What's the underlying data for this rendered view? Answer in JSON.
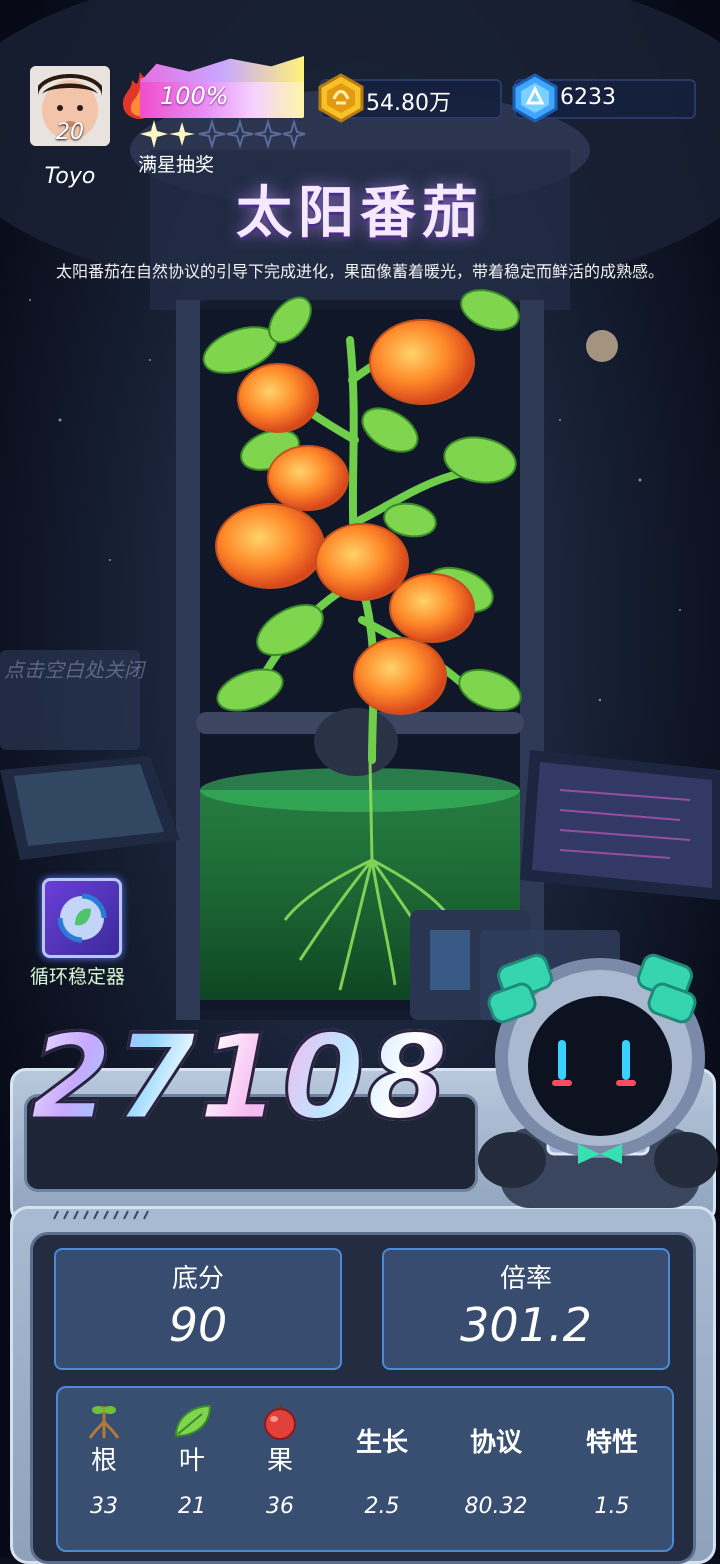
{
  "player": {
    "level": "20",
    "name": "Toyo",
    "progress_percent": "100%",
    "progress_fraction": 1.0,
    "stars_filled": 2,
    "stars_total": 6,
    "lottery_label": "满星抽奖"
  },
  "currency": {
    "coins": "54.80万",
    "coin_icon": "gold-coin-icon",
    "gems": "6233",
    "gem_icon": "blue-gem-icon"
  },
  "plant": {
    "title": "太阳番茄",
    "description": "太阳番茄在自然协议的引导下完成进化，果面像蓄着暖光，带着稳定而鲜活的成熟感。"
  },
  "close_hint": "点击空白处关闭",
  "stabilizer": {
    "label": "循环稳定器",
    "icon": "cycle-leaf-icon"
  },
  "score": {
    "total": "27108",
    "base_label": "底分",
    "base_value": "90",
    "multiplier_label": "倍率",
    "multiplier_value": "301.2"
  },
  "attributes": [
    {
      "label": "根",
      "value": "33",
      "icon": "root-icon"
    },
    {
      "label": "叶",
      "value": "21",
      "icon": "leaf-icon"
    },
    {
      "label": "果",
      "value": "36",
      "icon": "apple-icon"
    },
    {
      "label": "生长",
      "value": "2.5"
    },
    {
      "label": "协议",
      "value": "80.32"
    },
    {
      "label": "特性",
      "value": "1.5"
    }
  ],
  "colors": {
    "background": "#0b0f1e",
    "panel": "#232c40",
    "stat_box": "#374c6e",
    "accent_border": "#4a8ad6",
    "coin": "#f5b81c",
    "gem": "#3fa6ff",
    "tube_liquid": "#1f8a3a"
  }
}
